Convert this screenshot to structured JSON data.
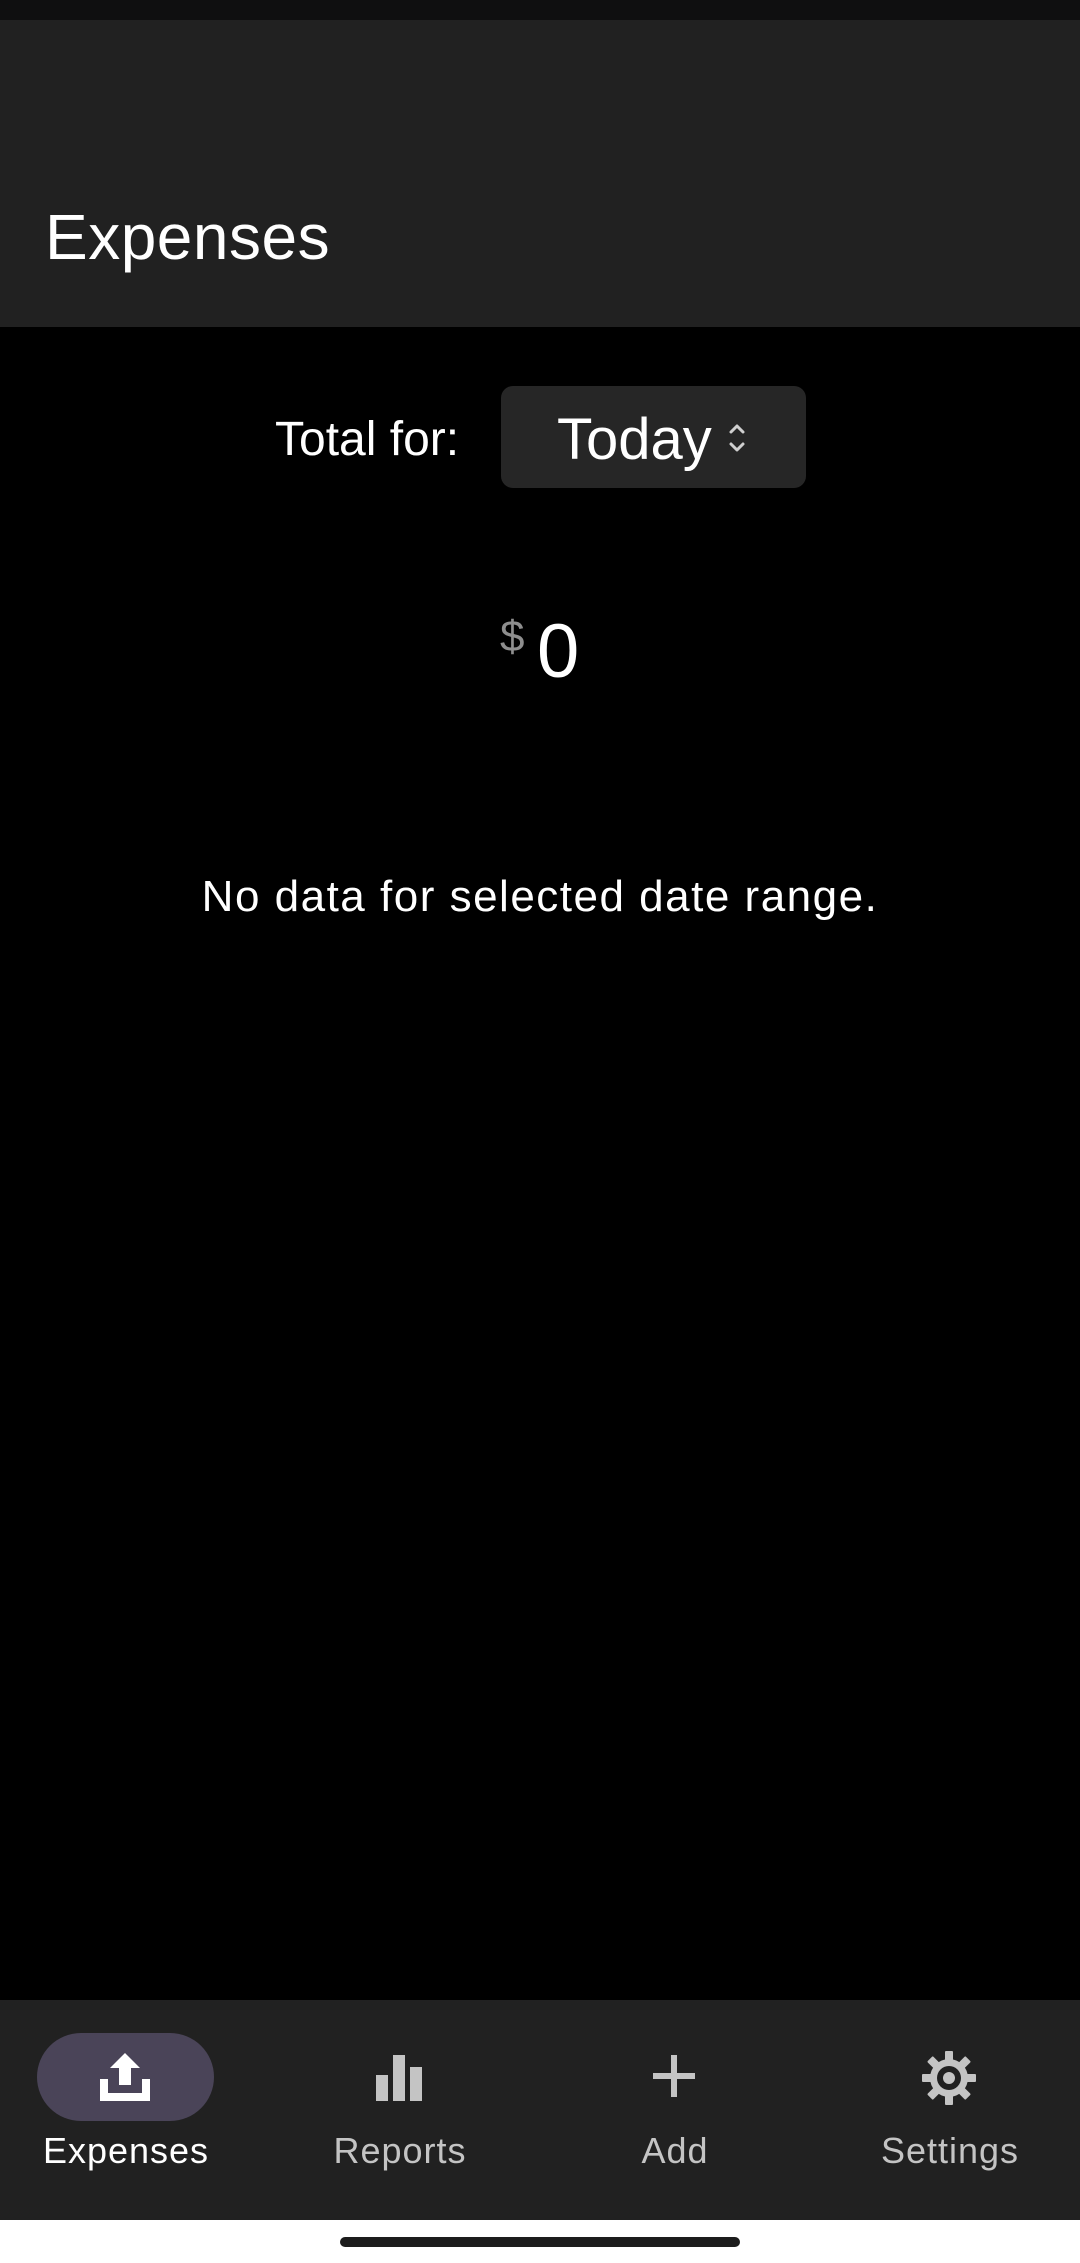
{
  "app_bar": {
    "title": "Expenses"
  },
  "total": {
    "label": "Total for:",
    "period_selected": "Today",
    "currency_symbol": "$",
    "amount": "0"
  },
  "empty_state": {
    "message": "No data for selected date range."
  },
  "bottom_nav": {
    "items": [
      {
        "label": "Expenses",
        "icon": "upload-icon",
        "active": true
      },
      {
        "label": "Reports",
        "icon": "bar-chart-icon",
        "active": false
      },
      {
        "label": "Add",
        "icon": "plus-icon",
        "active": false
      },
      {
        "label": "Settings",
        "icon": "gear-icon",
        "active": false
      }
    ]
  },
  "colors": {
    "background": "#000000",
    "surface": "#212121",
    "active_pill": "#4a4458",
    "inactive_label": "#c4c4c4",
    "muted": "#8e8e8e"
  }
}
